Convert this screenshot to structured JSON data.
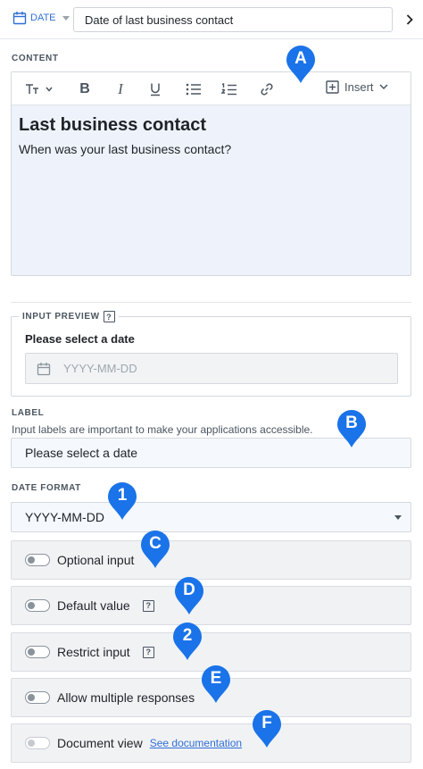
{
  "header": {
    "type_label": "DATE",
    "title_value": "Date of last business contact"
  },
  "content": {
    "section_label": "CONTENT",
    "toolbar": {
      "insert_label": "Insert"
    },
    "heading": "Last business contact",
    "body": "When was your last business contact?"
  },
  "preview": {
    "section_label": "INPUT PREVIEW",
    "help_glyph": "?",
    "field_label": "Please select a date",
    "placeholder": "YYYY-MM-DD"
  },
  "label": {
    "section_label": "LABEL",
    "help_text": "Input labels are important to make your applications accessible.",
    "value": "Please select a date"
  },
  "date_format": {
    "section_label": "DATE FORMAT",
    "selected": "YYYY-MM-DD"
  },
  "options": [
    {
      "label": "Optional input",
      "enabled": false
    },
    {
      "label": "Default value",
      "enabled": false,
      "help_glyph": "?"
    },
    {
      "label": "Restrict input",
      "enabled": false,
      "help_glyph": "?"
    },
    {
      "label": "Allow multiple responses",
      "enabled": false
    },
    {
      "label": "Document view",
      "enabled": false,
      "link": "See documentation"
    }
  ],
  "markers": {
    "a": "A",
    "b": "B",
    "c": "C",
    "d": "D",
    "e": "E",
    "f": "F",
    "one": "1",
    "two": "2",
    "color": "#1a73e8"
  },
  "colors": {
    "accent": "#2f6fd6",
    "editor_bg": "#eef3fb",
    "option_bg": "#f1f2f4"
  }
}
